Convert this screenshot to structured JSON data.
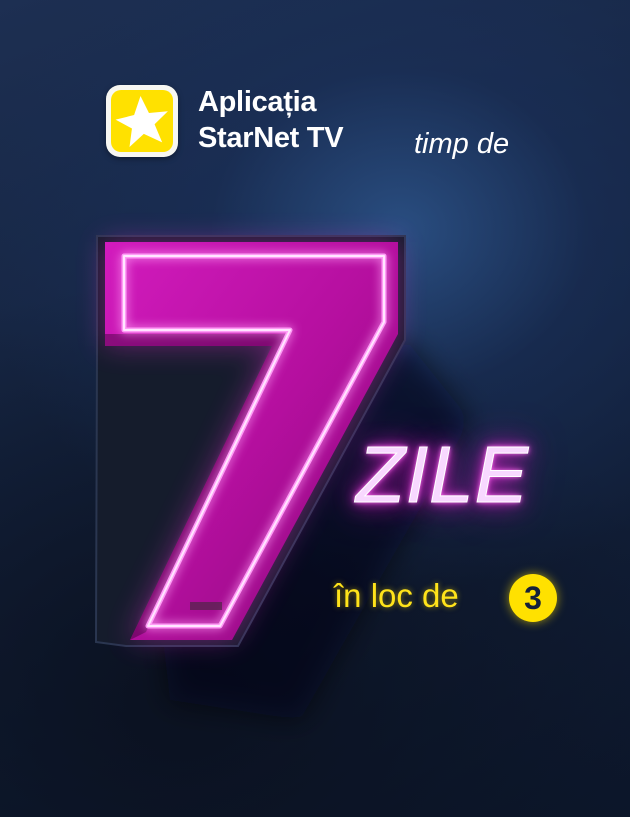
{
  "app": {
    "name_line1": "Aplicația",
    "name_line2": "StarNet TV",
    "icon": "starnet-star-icon"
  },
  "headline": {
    "prefix": "timp de",
    "big_number": "7",
    "unit": "ZILE",
    "compare_text": "în loc de",
    "compare_number": "3"
  },
  "colors": {
    "neon_pink": "#ff3ff0",
    "accent_yellow": "#ffe100",
    "background": "#14233f"
  }
}
